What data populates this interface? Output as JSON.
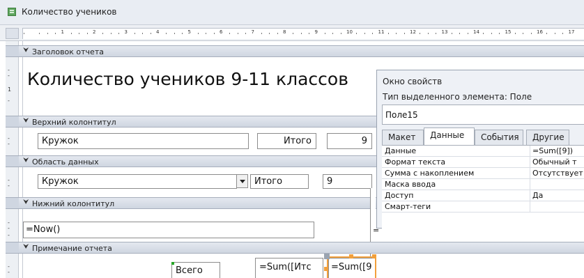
{
  "window": {
    "title": "Количество учеников"
  },
  "ruler": {
    "numbers": [
      "1",
      "2",
      "3",
      "4",
      "5",
      "6",
      "7",
      "8",
      "9",
      "10",
      "11",
      "12",
      "13",
      "14",
      "15",
      "16",
      "17"
    ]
  },
  "vruler": {
    "mark1": "1"
  },
  "sections": {
    "report_header": "Заголовок отчета",
    "page_header": "Верхний колонтитул",
    "detail": "Область данных",
    "page_footer": "Нижний колонтитул",
    "report_footer": "Примечание отчета"
  },
  "controls": {
    "report_title": "Количество учеников 9-11 классов",
    "ph_kruzhok": "Кружок",
    "ph_itogo": "Итого",
    "ph_value": "9",
    "d_kruzhok": "Кружок",
    "d_itogo": "Итого",
    "d_value": "9",
    "pf_now": "=Now()",
    "pf_side": "=",
    "rf_vsego": "Всего",
    "rf_sum1": "=Sum([Итс",
    "rf_sum2": "=Sum([9"
  },
  "property_sheet": {
    "title": "Окно свойств",
    "type_label": "Тип выделенного элемента:  Поле",
    "selected_name": "Поле15",
    "tabs": [
      "Макет",
      "Данные",
      "События",
      "Другие"
    ],
    "active_tab": "Данные",
    "rows": [
      {
        "label": "Данные",
        "value": "=Sum([9])"
      },
      {
        "label": "Формат текста",
        "value": "Обычный т"
      },
      {
        "label": "Сумма с накоплением",
        "value": "Отсутствует"
      },
      {
        "label": "Маска ввода",
        "value": ""
      },
      {
        "label": "Доступ",
        "value": "Да"
      },
      {
        "label": "Смарт-теги",
        "value": ""
      }
    ]
  },
  "colors": {
    "selection": "#f2a03c",
    "band": "#cfd6e1",
    "panel": "#eef1f6"
  }
}
